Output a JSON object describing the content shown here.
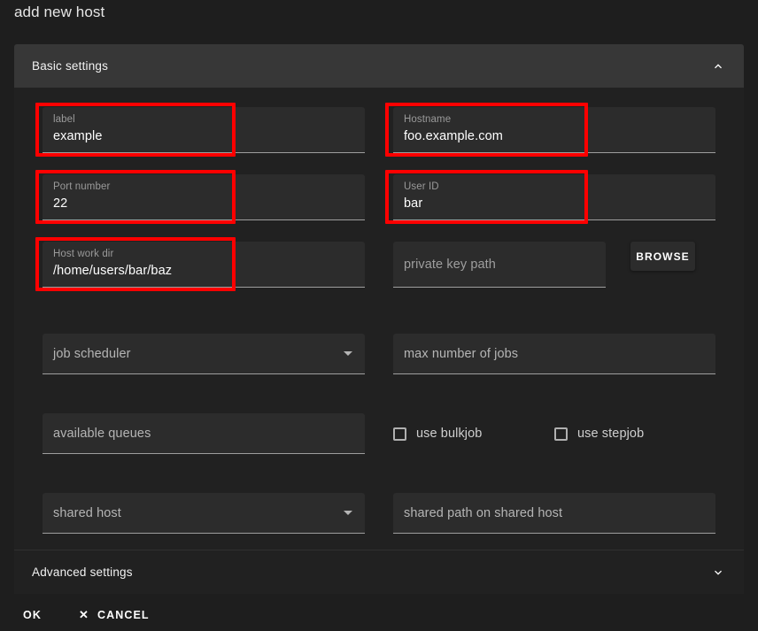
{
  "page_title": "add new host",
  "colors": {
    "background": "#1e1e1e",
    "panel": "#212121",
    "panel_header": "#373737",
    "field": "#2c2c2c",
    "highlight": "#ff0000",
    "text": "#ffffff",
    "muted_text": "#9e9e9e"
  },
  "basic_panel": {
    "title": "Basic settings",
    "chevron_icon": "chevron-up-icon",
    "expanded": true
  },
  "advanced_panel": {
    "title": "Advanced settings",
    "chevron_icon": "chevron-down-icon",
    "expanded": false
  },
  "fields": {
    "label": {
      "label": "label",
      "value": "example",
      "highlighted": true
    },
    "hostname": {
      "label": "Hostname",
      "value": "foo.example.com",
      "highlighted": true
    },
    "port": {
      "label": "Port number",
      "value": "22",
      "highlighted": true
    },
    "user_id": {
      "label": "User ID",
      "value": "bar",
      "highlighted": true
    },
    "host_work_dir": {
      "label": "Host work dir",
      "value": "/home/users/bar/baz",
      "highlighted": true
    },
    "private_key_path": {
      "placeholder": "private key path",
      "value": "",
      "highlighted": false
    },
    "job_scheduler": {
      "placeholder": "job scheduler",
      "value": "",
      "icon": "chevron-down-icon"
    },
    "max_number_of_jobs": {
      "placeholder": "max number of jobs",
      "value": ""
    },
    "available_queues": {
      "placeholder": "available queues",
      "value": ""
    },
    "shared_host": {
      "placeholder": "shared host",
      "value": "",
      "icon": "chevron-down-icon"
    },
    "shared_path_on_shared_host": {
      "placeholder": "shared path on shared host",
      "value": ""
    }
  },
  "buttons": {
    "browse": "BROWSE",
    "ok": "OK",
    "cancel": "CANCEL",
    "cancel_icon": "close-x-icon"
  },
  "checkboxes": [
    {
      "label": "use bulkjob",
      "checked": false,
      "icon": "checkbox-unchecked-icon"
    },
    {
      "label": "use stepjob",
      "checked": false,
      "icon": "checkbox-unchecked-icon"
    }
  ]
}
